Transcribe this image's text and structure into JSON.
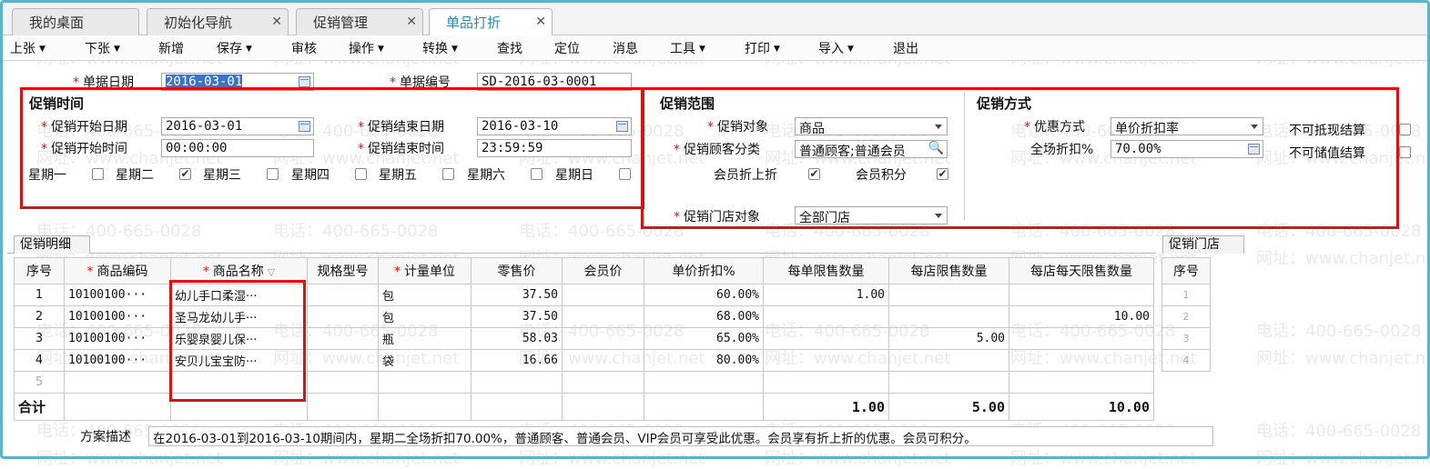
{
  "tabs": [
    {
      "label": "我的桌面",
      "closable": false
    },
    {
      "label": "初始化导航",
      "closable": true
    },
    {
      "label": "促销管理",
      "closable": true
    },
    {
      "label": "单品打折",
      "closable": true,
      "active": true
    }
  ],
  "menu": [
    "上张",
    "下张",
    "新增",
    "保存",
    "审核",
    "操作",
    "转换",
    "查找",
    "定位",
    "消息",
    "工具",
    "打印",
    "导入",
    "退出"
  ],
  "header": {
    "date_label": "单据日期",
    "date_value": "2016-03-01",
    "number_label": "单据编号",
    "number_value": "SD-2016-03-0001"
  },
  "time_section": {
    "title": "促销时间",
    "start_date_label": "促销开始日期",
    "start_date": "2016-03-01",
    "end_date_label": "促销结束日期",
    "end_date": "2016-03-10",
    "start_time_label": "促销开始时间",
    "start_time": "00:00:00",
    "end_time_label": "促销结束时间",
    "end_time": "23:59:59",
    "weekdays": [
      {
        "label": "星期一",
        "checked": false
      },
      {
        "label": "星期二",
        "checked": true
      },
      {
        "label": "星期三",
        "checked": false
      },
      {
        "label": "星期四",
        "checked": false
      },
      {
        "label": "星期五",
        "checked": false
      },
      {
        "label": "星期六",
        "checked": false
      },
      {
        "label": "星期日",
        "checked": false
      }
    ]
  },
  "scope_section": {
    "title": "促销范围",
    "target_label": "促销对象",
    "target_value": "商品",
    "customer_label": "促销顾客分类",
    "customer_value": "普通顾客;普通会员",
    "member_discount_label": "会员折上折",
    "member_discount": true,
    "member_points_label": "会员积分",
    "member_points": true,
    "store_label": "促销门店对象",
    "store_value": "全部门店"
  },
  "method_section": {
    "title": "促销方式",
    "method_label": "优惠方式",
    "method_value": "单价折扣率",
    "discount_label": "全场折扣%",
    "discount_value": "70.00%",
    "no_cash_label": "不可抵现结算",
    "no_stored_label": "不可储值结算"
  },
  "detail": {
    "tab_label": "促销明细",
    "columns": [
      "序号",
      "商品编码",
      "商品名称",
      "规格型号",
      "计量单位",
      "零售价",
      "会员价",
      "单价折扣%",
      "每单限售数量",
      "每店限售数量",
      "每店每天限售数量"
    ],
    "required_columns": [
      1,
      2,
      4
    ],
    "rows": [
      {
        "no": "1",
        "code": "10100100···",
        "name": "幼儿手口柔湿···",
        "spec": "",
        "unit": "包",
        "price": "37.50",
        "member_price": "",
        "discount": "60.00%",
        "per_order": "1.00",
        "per_store": "",
        "per_store_day": ""
      },
      {
        "no": "2",
        "code": "10100100···",
        "name": "圣马龙幼儿手···",
        "spec": "",
        "unit": "包",
        "price": "37.50",
        "member_price": "",
        "discount": "68.00%",
        "per_order": "",
        "per_store": "",
        "per_store_day": "10.00"
      },
      {
        "no": "3",
        "code": "10100100···",
        "name": "乐婴泉婴儿保···",
        "spec": "",
        "unit": "瓶",
        "price": "58.03",
        "member_price": "",
        "discount": "65.00%",
        "per_order": "",
        "per_store": "5.00",
        "per_store_day": ""
      },
      {
        "no": "4",
        "code": "10100100···",
        "name": "安贝儿宝宝防···",
        "spec": "",
        "unit": "袋",
        "price": "16.66",
        "member_price": "",
        "discount": "80.00%",
        "per_order": "",
        "per_store": "",
        "per_store_day": ""
      },
      {
        "no": "5",
        "code": "",
        "name": "",
        "spec": "",
        "unit": "",
        "price": "",
        "member_price": "",
        "discount": "",
        "per_order": "",
        "per_store": "",
        "per_store_day": ""
      }
    ],
    "total_label": "合计",
    "totals": {
      "per_order": "1.00",
      "per_store": "5.00",
      "per_store_day": "10.00"
    }
  },
  "store_panel": {
    "tab_label": "促销门店",
    "header": "序号",
    "rows": [
      "1",
      "2",
      "3",
      "4"
    ]
  },
  "footer": {
    "label": "方案描述",
    "text": "在2016-03-01到2016-03-10期间内，星期二全场折扣70.00%，普通顾客、普通会员、VIP会员可享受此优惠。会员享有折上折的优惠。会员可积分。"
  },
  "watermark": {
    "phone": "电话：400-665-0028",
    "site": "网址：www.chanjet.net"
  },
  "colors": {
    "accent": "#2a8bc0",
    "required": "#e01010",
    "highlight_box": "#e01010",
    "frame": "#5ab3c8"
  }
}
